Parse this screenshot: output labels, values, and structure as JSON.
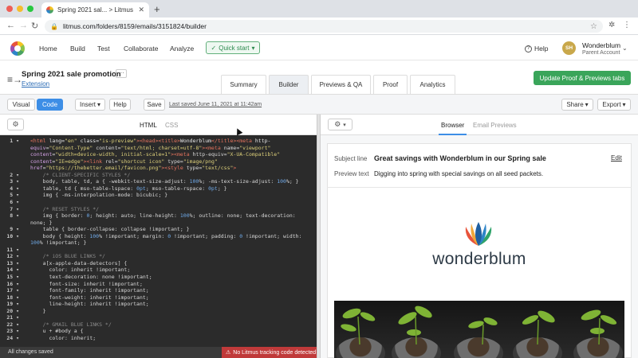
{
  "browser": {
    "tab_title": "Spring 2021 sal... > Litmus",
    "url": "litmus.com/folders/8159/emails/3151824/builder",
    "window_dot_colors": [
      "#ee5f57",
      "#f5bd2e",
      "#28c840"
    ]
  },
  "app_nav": {
    "items": [
      "Home",
      "Build",
      "Test",
      "Collaborate",
      "Analyze"
    ],
    "quick_start": "Quick start",
    "help": "Help",
    "avatar_initials": "SH",
    "account_name": "Wonderblum",
    "account_sub": "Parent Account"
  },
  "project": {
    "title": "Spring 2021 sale promotion",
    "more": "···",
    "extension": "Extension",
    "tabs": [
      "Summary",
      "Builder",
      "Previews & QA",
      "Proof",
      "Analytics"
    ],
    "active_tab": "Builder",
    "update_button": "Update Proof & Previews tabs"
  },
  "toolbar": {
    "visual": "Visual",
    "code": "Code",
    "insert": "Insert",
    "help": "Help",
    "save": "Save",
    "last_saved": "Last saved June 11, 2021 at 11:42am",
    "share": "Share",
    "export": "Export"
  },
  "editor": {
    "tabs": [
      "HTML",
      "CSS"
    ],
    "lines": [
      {
        "n": "1",
        "t": "<html lang=\"en\" class=\"is-preview\"><head><title>Wonderblum</title><meta http-"
      },
      {
        "n": "",
        "t": "equiv=\"Content-Type\" content=\"text/html; charset=utf-8\"><meta name=\"viewport\""
      },
      {
        "n": "",
        "t": "content=\"width=device-width, initial-scale=1\"><meta http-equiv=\"X-UA-Compatible\""
      },
      {
        "n": "",
        "t": "content=\"IE=edge\"><link rel=\"shortcut icon\" type=\"image/png\""
      },
      {
        "n": "",
        "t": "href=\"https://thebetter.email/favicon.png\"><style type=\"text/css\">"
      },
      {
        "n": "2",
        "t": "    /* CLIENT-SPECIFIC STYLES */"
      },
      {
        "n": "3",
        "t": "    body, table, td, a { -webkit-text-size-adjust: 100%; -ms-text-size-adjust: 100%; }"
      },
      {
        "n": "4",
        "t": "    table, td { mso-table-lspace: 0pt; mso-table-rspace: 0pt; }"
      },
      {
        "n": "5",
        "t": "    img { -ms-interpolation-mode: bicubic; }"
      },
      {
        "n": "6",
        "t": ""
      },
      {
        "n": "7",
        "t": "    /* RESET STYLES */"
      },
      {
        "n": "8",
        "t": "    img { border: 0; height: auto; line-height: 100%; outline: none; text-decoration:"
      },
      {
        "n": "",
        "t": "none; }"
      },
      {
        "n": "9",
        "t": "    table { border-collapse: collapse !important; }"
      },
      {
        "n": "10",
        "t": "    body { height: 100% !important; margin: 0 !important; padding: 0 !important; width:"
      },
      {
        "n": "",
        "t": "100% !important; }"
      },
      {
        "n": "11",
        "t": ""
      },
      {
        "n": "12",
        "t": "    /* iOS BLUE LINKS */"
      },
      {
        "n": "13",
        "t": "    a[x-apple-data-detectors] {"
      },
      {
        "n": "14",
        "t": "      color: inherit !important;"
      },
      {
        "n": "15",
        "t": "      text-decoration: none !important;"
      },
      {
        "n": "16",
        "t": "      font-size: inherit !important;"
      },
      {
        "n": "17",
        "t": "      font-family: inherit !important;"
      },
      {
        "n": "18",
        "t": "      font-weight: inherit !important;"
      },
      {
        "n": "19",
        "t": "      line-height: inherit !important;"
      },
      {
        "n": "20",
        "t": "    }"
      },
      {
        "n": "21",
        "t": ""
      },
      {
        "n": "22",
        "t": "    /* GMAIL BLUE LINKS */"
      },
      {
        "n": "23",
        "t": "    u + #body a {"
      },
      {
        "n": "24",
        "t": "      color: inherit;"
      }
    ],
    "status_left": "All changes saved",
    "status_right": "No Litmus tracking code detected"
  },
  "preview": {
    "tabs": [
      "Browser",
      "Email Previews"
    ],
    "active_tab": "Browser",
    "subject_label": "Subject line",
    "subject_value": "Great savings with Wonderblum in our Spring sale",
    "preview_label": "Preview text",
    "preview_value": "Digging into spring with special savings on all seed packets.",
    "edit": "Edit",
    "brand": "wonderblum"
  }
}
